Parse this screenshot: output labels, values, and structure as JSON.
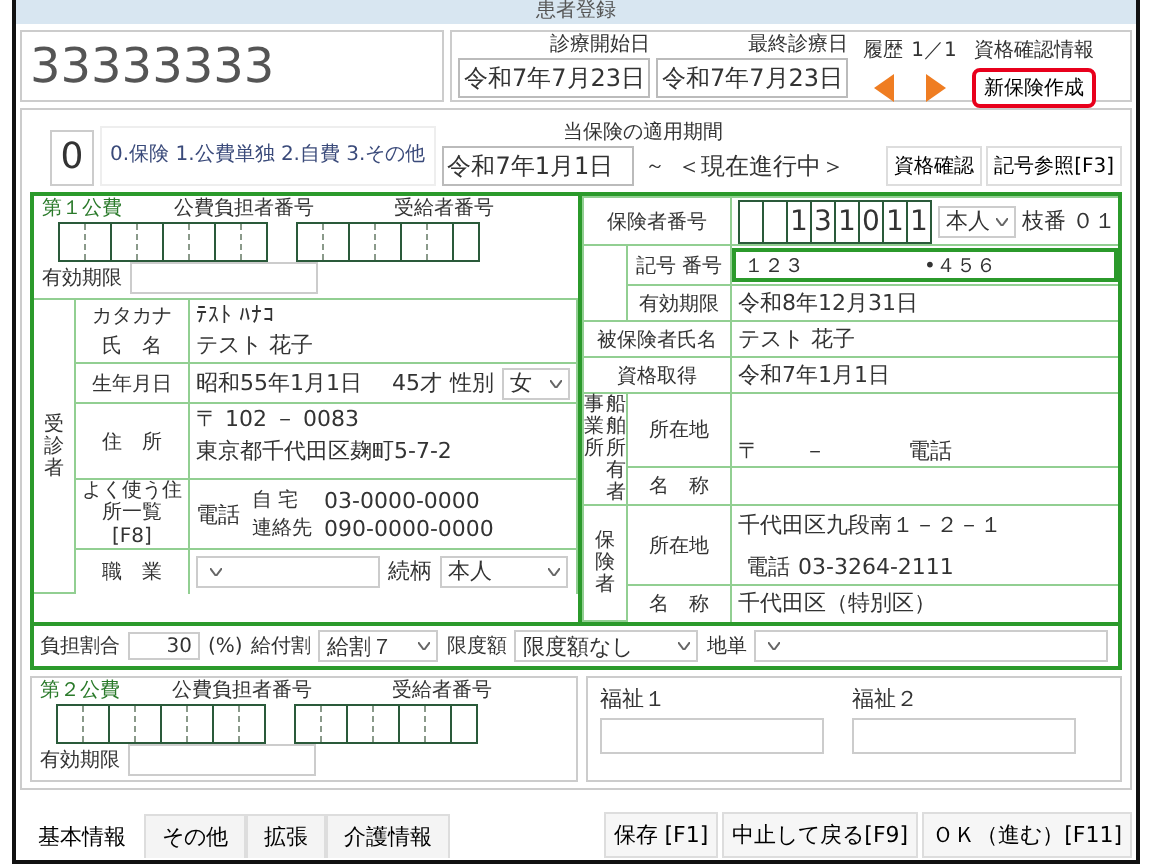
{
  "window": {
    "title": "患者登録"
  },
  "patient_id": "33333333",
  "visit_dates": [
    {
      "label": "診療開始日",
      "value": "令和7年7月23日"
    },
    {
      "label": "最終診療日",
      "value": "令和7年7月23日"
    }
  ],
  "history": {
    "label": "履歴",
    "count": "1／1"
  },
  "eligibility_info": "資格確認情報",
  "new_insurance_button": {
    "label": "新保険作成",
    "highlighted": true
  },
  "insurance_type": {
    "value": "0",
    "options": "0.保険 1.公費単独 2.自費 3.その他"
  },
  "period": {
    "label": "当保険の適用期間",
    "from": "令和7年1月1日",
    "separator": "～",
    "to": "＜現在進行中＞"
  },
  "top_buttons": [
    "資格確認",
    "記号参照[F3]"
  ],
  "public_funds": [
    {
      "title": "第１公費",
      "payer_label": "公費負担者番号",
      "recipient_label": "受給者番号",
      "validity_label": "有効期限"
    },
    {
      "title": "第２公費",
      "payer_label": "公費負担者番号",
      "recipient_label": "受給者番号",
      "validity_label": "有効期限"
    }
  ],
  "patient": {
    "section_label": "受診者",
    "kana_label": "カタカナ",
    "name_label": "氏　名",
    "kana": "ﾃｽﾄ ﾊﾅｺ",
    "name": "テスト 花子",
    "birth_label": "生年月日",
    "birth": "昭和55年1月1日",
    "age": "45才",
    "sex_label": "性別",
    "sex": "女",
    "address_label": "住　所",
    "address_list": "よく使う住所一覧",
    "address_list_key": "[F8]",
    "postal": "〒 102 － 0083",
    "address": "東京都千代田区麹町5-7-2",
    "phone_label": "電話",
    "phones": [
      {
        "label": "自 宅",
        "value": "03-0000-0000"
      },
      {
        "label": "連絡先",
        "value": "090-0000-0000"
      }
    ],
    "job_label": "職　業",
    "relation_label": "続柄",
    "relation": "本人"
  },
  "insured": {
    "insurer_label": "保険者番号",
    "insurer_number": "131011",
    "person": "本人",
    "branch_label": "枝番",
    "branch": "０１",
    "symbol_label": "記号 番号",
    "symbol": "１２３",
    "number": "•４５６",
    "expiry_label": "有効期限",
    "expiry": "令和8年12月31日",
    "holder_label": "被保険者氏名",
    "holder": "テスト 花子",
    "acquired_label": "資格取得",
    "acquired": "令和7年1月1日"
  },
  "employer": {
    "label_a": "事業所",
    "label_b": "船舶所有者",
    "location_label": "所在地",
    "postal": "〒　　－",
    "phone_label": "電話",
    "name_label": "名　称"
  },
  "insurer": {
    "label": "保険者",
    "location_label": "所在地",
    "address": "千代田区九段南１－２－１",
    "phone_label": "電話",
    "phone": "03-3264-2111",
    "name_label": "名　称",
    "name": "千代田区（特別区）"
  },
  "burden": {
    "label": "負担割合",
    "value": "30",
    "unit": "(%)",
    "benefit_label": "給付割",
    "benefit": "給割７",
    "limit_label": "限度額",
    "limit": "限度額なし",
    "local_label": "地単"
  },
  "welfare": [
    {
      "label": "福祉１"
    },
    {
      "label": "福祉２"
    }
  ],
  "tabs": [
    {
      "label": "基本情報",
      "selected": true
    },
    {
      "label": "その他",
      "selected": false
    },
    {
      "label": "拡張",
      "selected": false
    },
    {
      "label": "介護情報",
      "selected": false
    }
  ],
  "footer_buttons": [
    "保存 [F1]",
    "中止して戻る[F9]",
    "ＯＫ（進む）[F11]"
  ]
}
